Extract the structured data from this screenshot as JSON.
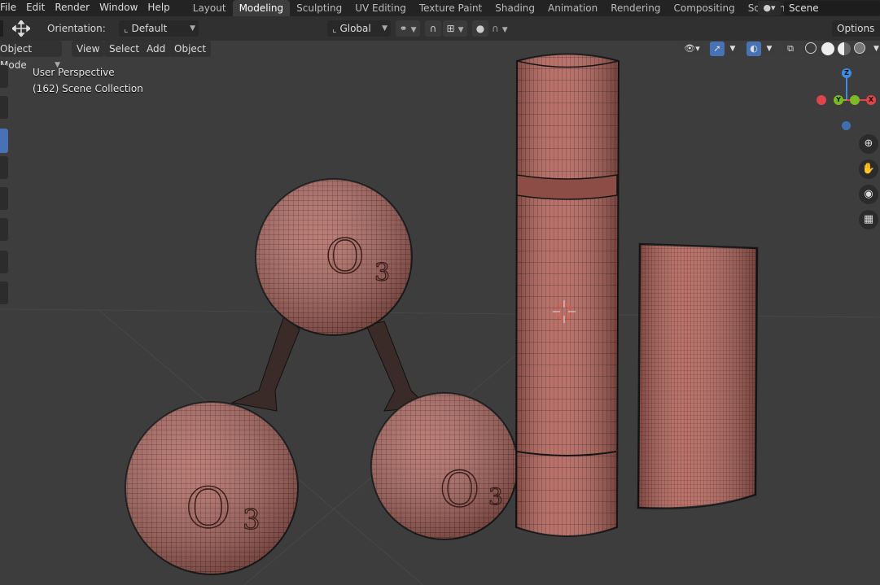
{
  "menu": [
    "File",
    "Edit",
    "Render",
    "Window",
    "Help"
  ],
  "workspaces": [
    {
      "label": "Layout",
      "active": false
    },
    {
      "label": "Modeling",
      "active": true
    },
    {
      "label": "Sculpting",
      "active": false
    },
    {
      "label": "UV Editing",
      "active": false
    },
    {
      "label": "Texture Paint",
      "active": false
    },
    {
      "label": "Shading",
      "active": false
    },
    {
      "label": "Animation",
      "active": false
    },
    {
      "label": "Rendering",
      "active": false
    },
    {
      "label": "Compositing",
      "active": false
    },
    {
      "label": "Scripting",
      "active": false
    }
  ],
  "add_workspace": "+",
  "scene": {
    "name": "Scene"
  },
  "toolheader": {
    "orientation_label": "Orientation:",
    "orientation_value": "Default",
    "transform_orientation": "Global",
    "options_label": "Options"
  },
  "viewport_header": {
    "mode": "Object Mode",
    "menus": [
      "View",
      "Select",
      "Add",
      "Object"
    ]
  },
  "overlay": {
    "perspective": "User Perspective",
    "collection": "(162) Scene Collection"
  },
  "gizmo": {
    "x": "X",
    "y": "Y",
    "z": "Z"
  },
  "colors": {
    "accent": "#4772b3",
    "mesh": "#b56a62",
    "axis_x": "#e0444b",
    "axis_y": "#7cb927",
    "axis_z": "#3f8be3"
  },
  "icons": {
    "move": "move-arrows-icon",
    "snap": "magnet-icon",
    "proportional": "circle-dot-icon",
    "zoom": "magnifier-icon",
    "pan": "hand-icon",
    "camera": "camera-icon",
    "grid": "grid-icon"
  }
}
